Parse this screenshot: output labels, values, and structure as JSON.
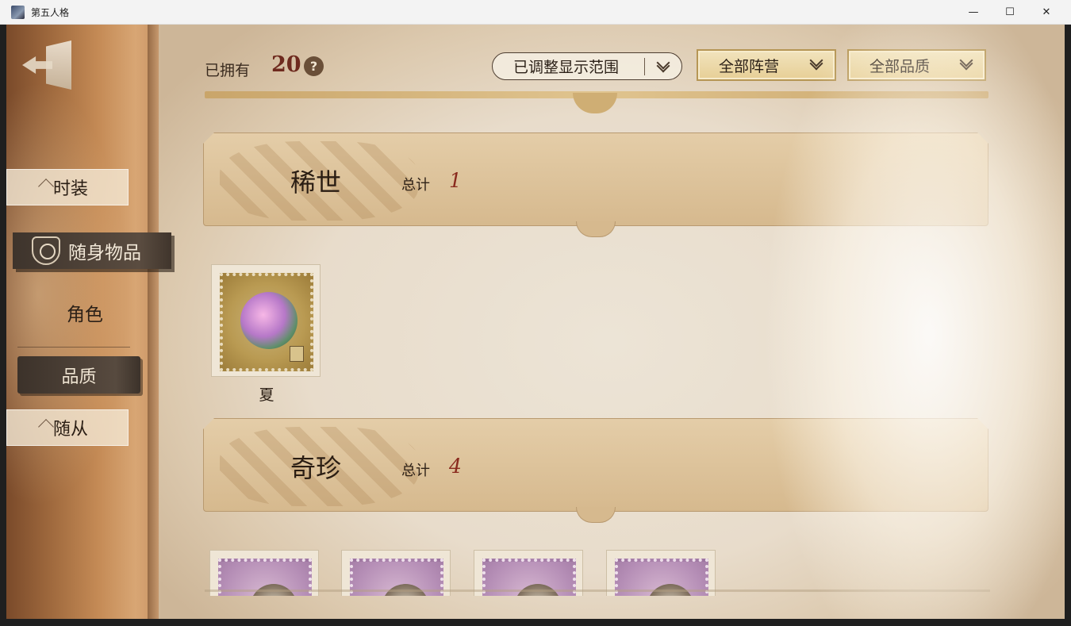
{
  "window": {
    "title": "第五人格"
  },
  "topbar": {
    "owned_label": "已拥有",
    "owned_count": "20",
    "help": "?",
    "range_dropdown": "已调整显示范围",
    "camp_dropdown": "全部阵营",
    "quality_dropdown": "全部品质"
  },
  "sidebar": {
    "tab_outfits": "时装",
    "tab_accessories": "随身物品",
    "sub_character": "角色",
    "sub_quality": "品质",
    "tab_followers": "随从"
  },
  "sections": [
    {
      "name": "稀世",
      "total_label": "总计",
      "total": "1",
      "items": [
        {
          "name": "夏"
        }
      ]
    },
    {
      "name": "奇珍",
      "total_label": "总计",
      "total": "4",
      "items": []
    }
  ],
  "colors": {
    "accent_red": "#8a2a1e",
    "sidebar_active": "#4a3e34",
    "dropdown_gold": "#e7cf96"
  }
}
